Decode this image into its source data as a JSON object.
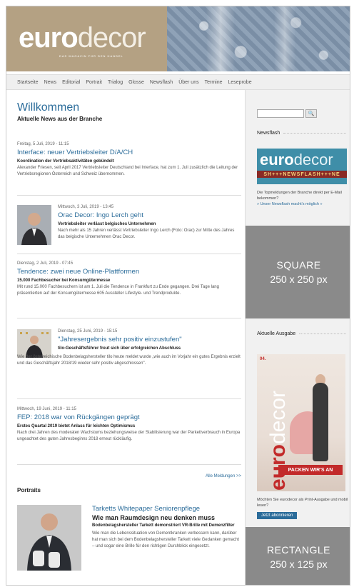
{
  "header": {
    "logo_euro": "euro",
    "logo_decor": "decor",
    "tagline": "DAS MAGAZIN FÜR DEN HANDEL"
  },
  "nav": [
    "Startseite",
    "News",
    "Editorial",
    "Portrait",
    "Trialog",
    "Glosse",
    "Newsflash",
    "Über uns",
    "Termine",
    "Leseprobe"
  ],
  "main": {
    "welcome": "Willkommen",
    "subwelcome": "Aktuelle News aus der Branche",
    "news": [
      {
        "date": "Freitag, 5 Juli, 2019 - 11:15",
        "title": "Interface: neuer Vertriebsleiter D/A/CH",
        "lead": "Koordination der Vertriebsaktivitäten gebündelt",
        "body": "Alexander Friesen, seit April 2017 Vertriebsleiter Deutschland bei Interface, hat zum 1. Juli zusätzlich die Leitung der Vertriebsregionen Österreich und Schweiz übernommen."
      },
      {
        "date": "Mittwoch, 3 Juli, 2019 - 13:45",
        "title": "Orac Decor: Ingo Lerch geht",
        "lead": "Vertriebsleiter verlässt belgisches Unternehmen",
        "body": "Nach mehr als 15 Jahren verlässt Vertriebsleiter Ingo Lerch (Foto: Orac) zur Mitte des Jahres das belgische Unternehmen Orac Decor."
      },
      {
        "date": "Dienstag, 2 Juli, 2019 - 07:45",
        "title": "Tendence: zwei neue Online-Plattformen",
        "lead": "15.000 Fachbesucher bei Konsumgütermesse",
        "body": "Mit rund 15.000 Fachbesuchern ist am 1. Juli die Tendence in Frankfurt zu Ende gegangen. Drei Tage lang präsentierten auf der Konsumgütermesse 605 Aussteller Lifestyle- und Trendprodukte."
      },
      {
        "date": "Dienstag, 25 Juni, 2019 - 15:15",
        "title": "\"Jahresergebnis sehr positiv einzustufen\"",
        "lead": "tilo-Geschäftsführer freut sich über erfolgreichen Abschluss",
        "body": "Wie der österreichische Bodenbelagshersteller tilo heute meldet wurde „wie auch im Vorjahr ein gutes Ergebnis erzielt und das Geschäftsjahr 2018/19 wieder sehr positiv abgeschlossen\"."
      },
      {
        "date": "Mittwoch, 19 Juni, 2019 - 11:15",
        "title": "FEP: 2018 war von Rückgängen geprägt",
        "lead": "Erstes Quartal 2019 bietet Anlass für leichten Optimismus",
        "body": "Nach drei Jahren des moderaten Wachstums beziehungsweise der Stabilisierung war der Parkettverbrauch in Europa ungeachtet des guten Jahresbeginns 2018 erneut rückläufig."
      }
    ],
    "all_news": "Alle Meldungen >>",
    "portraits_heading": "Portraits",
    "portrait": {
      "title": "Tarketts Whitepaper Seniorenpflege",
      "subtitle": "Wie man Raumdesign neu denken muss",
      "lead": "Bodenbelagshersteller Tarkett demonstriert VR-Brille mit Demenzfilter",
      "body": "Wie man die Lebenssituation von Dementkranken verbessern kann, darüber hat man sich bei dem Bodenbelagshersteller Tarkett viele Gedanken gemacht – und sogar eine Brille für den richtigen Durchblick eingesetzt."
    }
  },
  "sidebar": {
    "search_button": "🔍",
    "newsflash_heading": "Newsflash",
    "nf_euro": "euro",
    "nf_decor": "decor",
    "nf_strip": "SH+++NEWSFLASH+++NE",
    "nf_text": "Die Topmeldungen der Branche direkt per E-Mail bekommen?",
    "nf_link": "» Unser Newsflash macht's möglich »",
    "ad_square_title": "SQUARE",
    "ad_square_size": "250 x 250 px",
    "issue_heading": "Aktuelle Ausgabe",
    "cover_issue": "04.",
    "cover_euro": "euro",
    "cover_decor": "decor",
    "cover_packen": "PACKEN WIR'S AN",
    "issue_text": "Möchten Sie eurodecor als Print-Ausgabe und mobil lesen?",
    "subscribe_button": "Jetzt abonnieren",
    "ad_rect_title": "RECTANGLE",
    "ad_rect_size": "250 x 125 px"
  }
}
